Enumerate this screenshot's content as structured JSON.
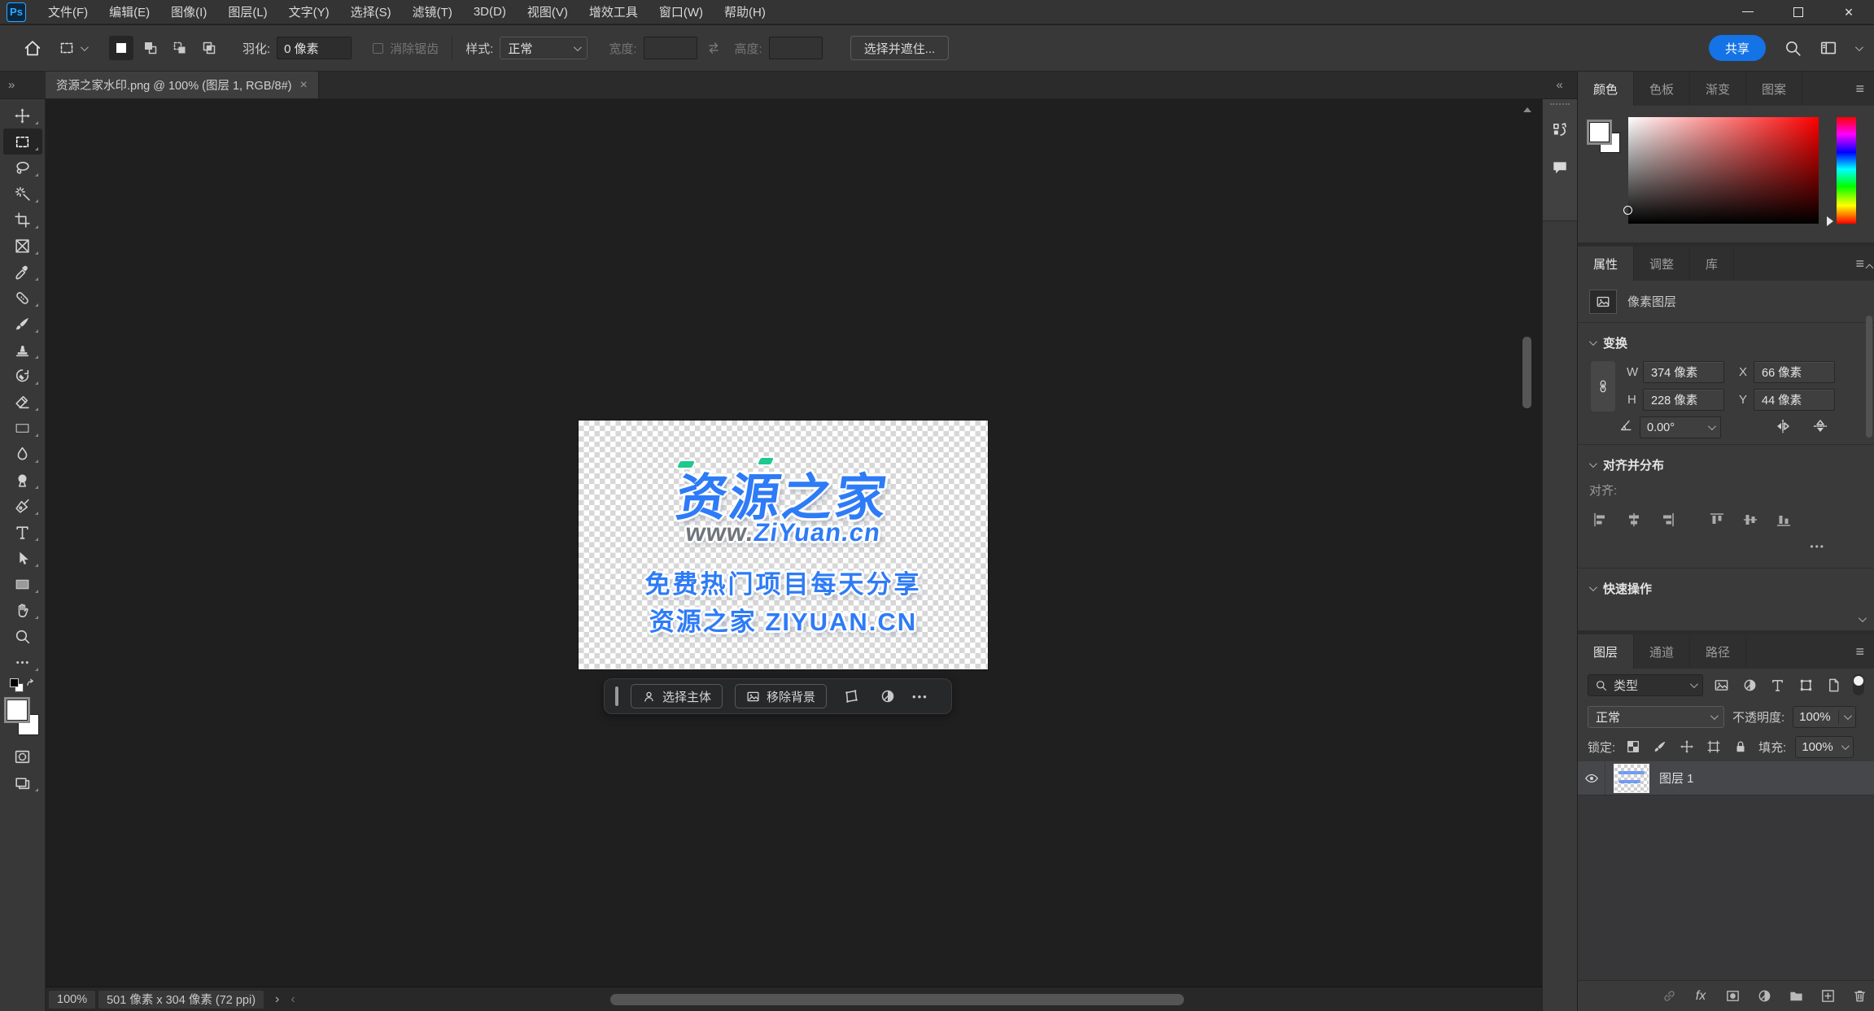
{
  "app": {
    "logo": "Ps"
  },
  "titlebar": {
    "menus": [
      "文件(F)",
      "编辑(E)",
      "图像(I)",
      "图层(L)",
      "文字(Y)",
      "选择(S)",
      "滤镜(T)",
      "3D(D)",
      "视图(V)",
      "增效工具",
      "窗口(W)",
      "帮助(H)"
    ]
  },
  "options_bar": {
    "feather_label": "羽化:",
    "feather_value": "0 像素",
    "antialias_label": "消除锯齿",
    "style_label": "样式:",
    "style_value": "正常",
    "width_label": "宽度:",
    "width_value": "",
    "height_label": "高度:",
    "height_value": "",
    "select_and_mask": "选择并遮住...",
    "share": "共享"
  },
  "document_tab": {
    "title": "资源之家水印.png @ 100% (图层 1, RGB/8#)",
    "close": "×"
  },
  "watermark": {
    "line1": "资源之家",
    "line2_gray": "www.",
    "line2_blue": "ZiYuan.cn",
    "line3": "免费热门项目每天分享",
    "line4": "资源之家 ZIYUAN.CN",
    "blue": "#2e7bf7",
    "green": "#1dc98c",
    "gray": "#6f757d"
  },
  "context_bar": {
    "select_subject": "选择主体",
    "remove_background": "移除背景",
    "more": "•••"
  },
  "color_panel": {
    "tabs": [
      "颜色",
      "色板",
      "渐变",
      "图案"
    ],
    "menu": "≡"
  },
  "properties_panel": {
    "tabs": [
      "属性",
      "调整",
      "库"
    ],
    "menu": "≡",
    "layer_kind": "像素图层",
    "transform": {
      "title": "变换",
      "w_label": "W",
      "w_value": "374 像素",
      "x_label": "X",
      "x_value": "66 像素",
      "h_label": "H",
      "h_value": "228 像素",
      "y_label": "Y",
      "y_value": "44 像素",
      "angle_value": "0.00°"
    },
    "align": {
      "title": "对齐并分布",
      "align_label": "对齐:",
      "more": "•••"
    },
    "quick_actions": {
      "title": "快速操作"
    }
  },
  "layers_panel": {
    "tabs": [
      "图层",
      "通道",
      "路径"
    ],
    "menu": "≡",
    "filter_type": "类型",
    "blend_mode": "正常",
    "opacity_label": "不透明度:",
    "opacity_value": "100%",
    "lock_label": "锁定:",
    "fill_label": "填充:",
    "fill_value": "100%",
    "layer_name": "图层 1",
    "fx_label": "fx"
  },
  "status_bar": {
    "zoom": "100%",
    "doc_info": "501 像素 x 304 像素 (72 ppi)",
    "expand": "›",
    "collapse": "‹"
  },
  "icons_text": {
    "collapse_right": "»",
    "collapse_left": "«"
  },
  "colors": {
    "accent": "#1473e6",
    "panel": "#3a3a3a",
    "canvas": "#1f1f1f"
  }
}
